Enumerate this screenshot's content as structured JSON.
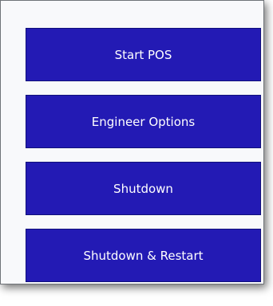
{
  "menu": {
    "buttons": [
      {
        "label": "Start POS"
      },
      {
        "label": "Engineer Options"
      },
      {
        "label": "Shutdown"
      },
      {
        "label": "Shutdown & Restart"
      }
    ]
  },
  "colors": {
    "button_background": "#231ab4",
    "button_text": "#ffffff",
    "panel_background": "#f8f9fb"
  }
}
